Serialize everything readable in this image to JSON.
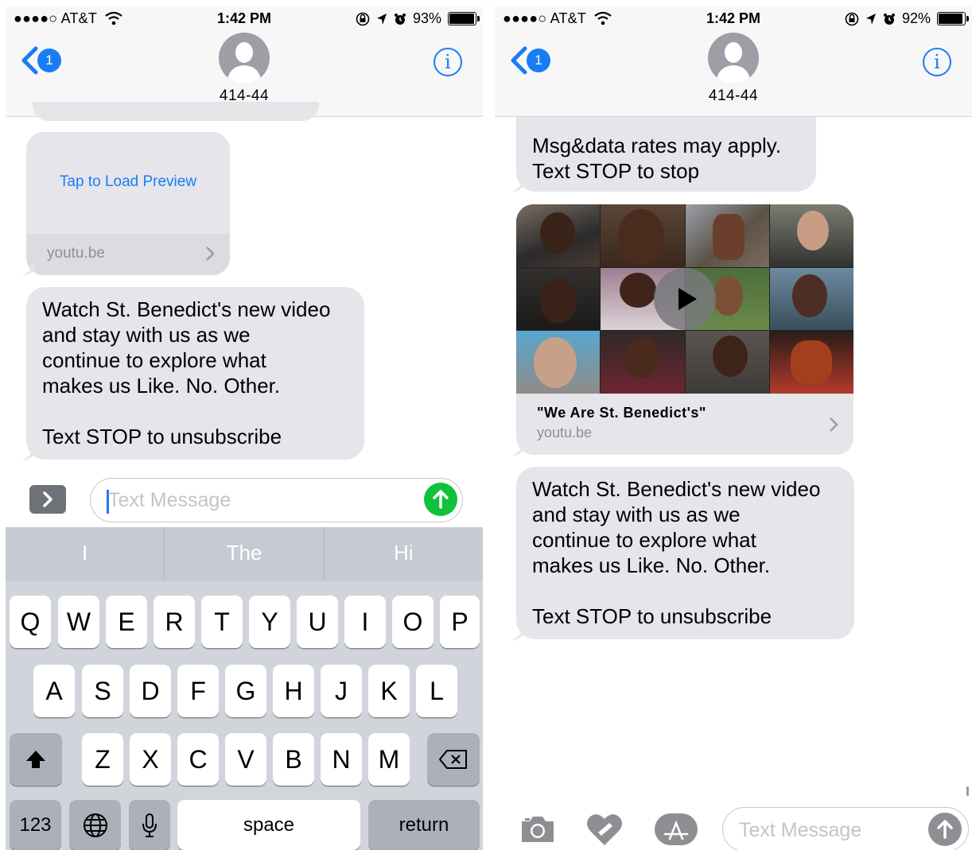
{
  "left": {
    "status": {
      "carrier": "●●●●○ AT&T",
      "time": "1:42 PM",
      "battery": "93%",
      "battery_level": 0.93
    },
    "header": {
      "badge_count": "1",
      "contact": "414-44",
      "info_label": "i"
    },
    "preview_card": {
      "action": "Tap to Load Preview",
      "domain": "youtu.be"
    },
    "message": {
      "lines": [
        "Watch St. Benedict's new video",
        "and stay with us as we",
        "continue to explore what",
        "makes us Like. No. Other.",
        "",
        "Text STOP to unsubscribe"
      ]
    },
    "compose": {
      "placeholder": "Text Message"
    },
    "keyboard": {
      "predictions": [
        "I",
        "The",
        "Hi"
      ],
      "row1": [
        "Q",
        "W",
        "E",
        "R",
        "T",
        "Y",
        "U",
        "I",
        "O",
        "P"
      ],
      "row2": [
        "A",
        "S",
        "D",
        "F",
        "G",
        "H",
        "J",
        "K",
        "L"
      ],
      "row3": [
        "Z",
        "X",
        "C",
        "V",
        "B",
        "N",
        "M"
      ],
      "numbers_key": "123",
      "space_key": "space",
      "return_key": "return"
    }
  },
  "right": {
    "status": {
      "carrier": "●●●●○ AT&T",
      "time": "1:42 PM",
      "battery": "92%",
      "battery_level": 0.92
    },
    "header": {
      "badge_count": "1",
      "contact": "414-44",
      "info_label": "i"
    },
    "top_message": {
      "lines": [
        "Msg&data rates may apply.",
        "Text STOP to stop"
      ]
    },
    "video_card": {
      "title": "\"We Are St. Benedict's\"",
      "domain": "youtu.be"
    },
    "message": {
      "lines": [
        "Watch St. Benedict's new video",
        "and stay with us as we",
        "continue to explore what",
        "makes us Like. No. Other.",
        "",
        "Text STOP to unsubscribe"
      ]
    },
    "compose": {
      "placeholder": "Text Message"
    }
  },
  "colors": {
    "accent": "#1a7cf5",
    "bubble": "#e5e5ea",
    "send_active": "#10c239",
    "keyboard": "#d1d5db"
  }
}
